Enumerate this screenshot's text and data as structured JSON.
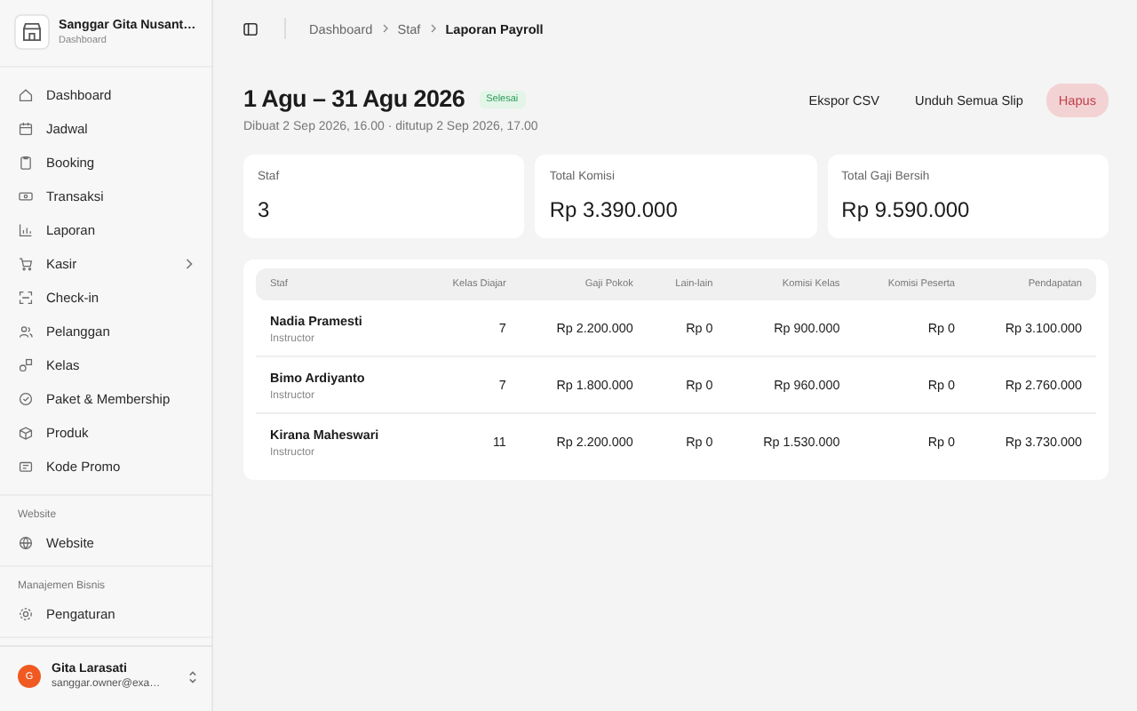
{
  "sidebar": {
    "brand": {
      "name": "Sanggar Gita Nusant…",
      "subtitle": "Dashboard"
    },
    "items": [
      {
        "label": "Dashboard",
        "kind": "home",
        "submenu": false
      },
      {
        "label": "Jadwal",
        "kind": "calendar",
        "submenu": false
      },
      {
        "label": "Booking",
        "kind": "clipboard",
        "submenu": false
      },
      {
        "label": "Transaksi",
        "kind": "ticket",
        "submenu": false
      },
      {
        "label": "Laporan",
        "kind": "chart",
        "submenu": false
      },
      {
        "label": "Kasir",
        "kind": "cart",
        "submenu": true
      },
      {
        "label": "Check-in",
        "kind": "scan",
        "submenu": false
      },
      {
        "label": "Pelanggan",
        "kind": "users",
        "submenu": false
      },
      {
        "label": "Kelas",
        "kind": "shapes",
        "submenu": false
      },
      {
        "label": "Paket & Membership",
        "kind": "badge",
        "submenu": false
      },
      {
        "label": "Produk",
        "kind": "box",
        "submenu": false
      },
      {
        "label": "Kode Promo",
        "kind": "tag",
        "submenu": false
      }
    ],
    "sections": [
      {
        "title": "Website",
        "items": [
          {
            "label": "Website",
            "kind": "globe"
          }
        ]
      },
      {
        "title": "Manajemen Bisnis",
        "items": [
          {
            "label": "Pengaturan",
            "kind": "settings"
          }
        ]
      }
    ],
    "user": {
      "initial": "G",
      "name": "Gita Larasati",
      "email": "sanggar.owner@exa…"
    }
  },
  "breadcrumb": [
    "Dashboard",
    "Staf",
    "Laporan Payroll"
  ],
  "header": {
    "title": "1 Agu – 31 Agu 2026",
    "status": "Selesai",
    "subtitle": "Dibuat 2 Sep 2026, 16.00 · ditutup 2 Sep 2026, 17.00"
  },
  "actions": [
    {
      "label": "Ekspor CSV",
      "kind": "plain"
    },
    {
      "label": "Unduh Semua Slip",
      "kind": "plain"
    },
    {
      "label": "Hapus",
      "kind": "danger"
    }
  ],
  "stats": [
    {
      "label": "Staf",
      "value": "3"
    },
    {
      "label": "Total Komisi",
      "value": "Rp 3.390.000"
    },
    {
      "label": "Total Gaji Bersih",
      "value": "Rp 9.590.000"
    }
  ],
  "table": {
    "columns": [
      "Staf",
      "Kelas Diajar",
      "Gaji Pokok",
      "Lain-lain",
      "Komisi Kelas",
      "Komisi Peserta",
      "Pendapatan"
    ],
    "rows": [
      {
        "role": "Instructor",
        "cells": [
          "Nadia Pramesti",
          "7",
          "Rp 2.200.000",
          "Rp 0",
          "Rp 900.000",
          "Rp 0",
          "Rp 3.100.000"
        ]
      },
      {
        "role": "Instructor",
        "cells": [
          "Bimo Ardiyanto",
          "7",
          "Rp 1.800.000",
          "Rp 0",
          "Rp 960.000",
          "Rp 0",
          "Rp 2.760.000"
        ]
      },
      {
        "role": "Instructor",
        "cells": [
          "Kirana Maheswari",
          "11",
          "Rp 2.200.000",
          "Rp 0",
          "Rp 1.530.000",
          "Rp 0",
          "Rp 3.730.000"
        ]
      }
    ]
  }
}
